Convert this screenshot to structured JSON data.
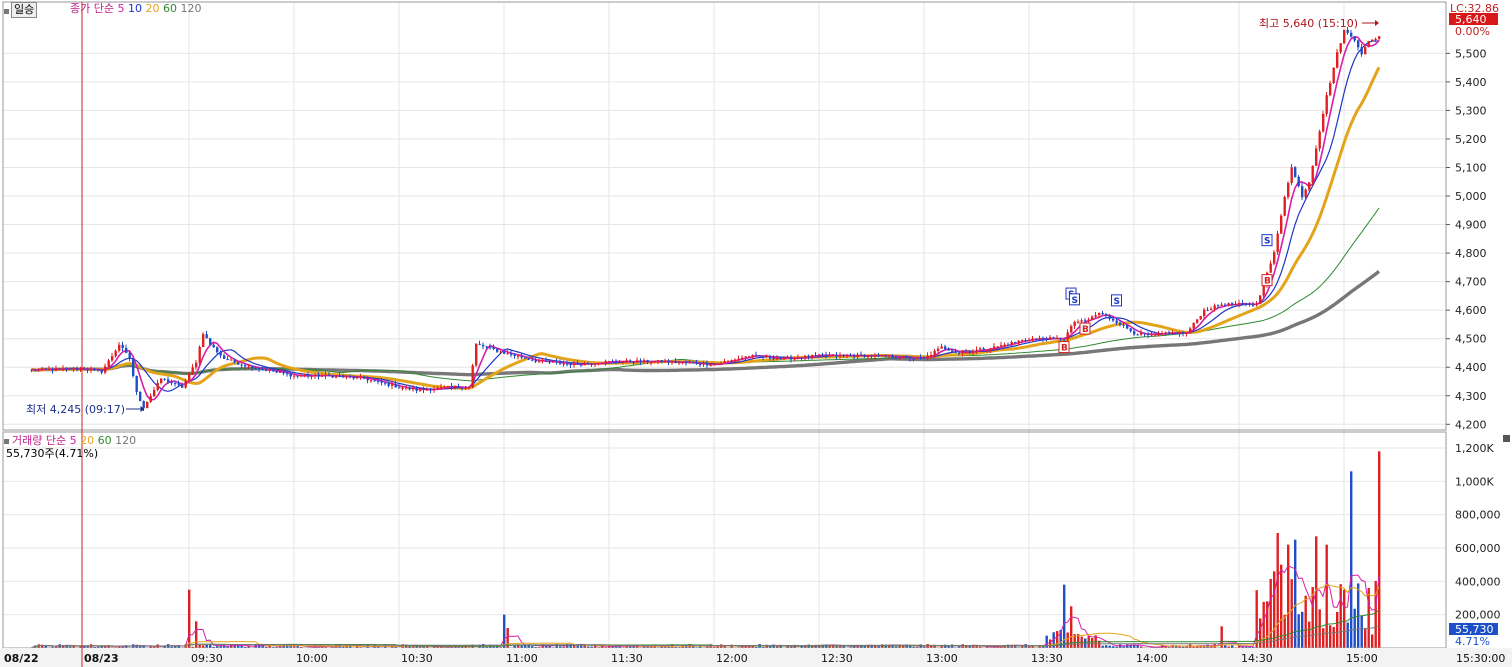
{
  "toolbar": {
    "period_button": "일승"
  },
  "price_legend": {
    "label": "종가 단순",
    "periods": [
      {
        "v": "5",
        "color": "#d81ea9"
      },
      {
        "v": "10",
        "color": "#1c36c9"
      },
      {
        "v": "20",
        "color": "#e3a41a"
      },
      {
        "v": "60",
        "color": "#2f8a2f"
      },
      {
        "v": "120",
        "color": "#777777"
      }
    ]
  },
  "volume_legend": {
    "label": "거래량 단순",
    "periods": [
      {
        "v": "5",
        "color": "#d81ea9"
      },
      {
        "v": "20",
        "color": "#e3a41a"
      },
      {
        "v": "60",
        "color": "#2f8a2f"
      },
      {
        "v": "120",
        "color": "#777777"
      }
    ],
    "current": "55,730주(4.71%)"
  },
  "axis_badges": {
    "lc": "LC:32.86",
    "last_price": "5,640",
    "change": "0.00%",
    "last_volume": "55,730",
    "volume_pct": "4.71%"
  },
  "annotations": {
    "high": "최고 5,640 (15:10)",
    "low": "최저 4,245 (09:17)"
  },
  "colors": {
    "up": "#e02020",
    "down": "#1c4fc8",
    "grid": "#e6e6e6"
  },
  "chart_data": {
    "type": "candlestick+volume",
    "x_axis_labels": [
      "08/22",
      "08/23",
      "09:30",
      "10:00",
      "10:30",
      "11:00",
      "11:30",
      "12:00",
      "12:30",
      "13:00",
      "13:30",
      "14:00",
      "14:30",
      "15:00",
      "15:30:00"
    ],
    "price_axis": {
      "ticks": [
        "4,200",
        "4,300",
        "4,400",
        "4,500",
        "4,600",
        "4,700",
        "4,800",
        "4,900",
        "5,000",
        "5,100",
        "5,200",
        "5,300",
        "5,400",
        "5,500"
      ],
      "ylim": [
        4180,
        5680
      ]
    },
    "volume_axis": {
      "ticks": [
        "200,000",
        "400,000",
        "600,000",
        "800,000",
        "1,000K",
        "1,200K"
      ],
      "ylim": [
        0,
        1200000
      ]
    },
    "time_start": "08:45",
    "interval_minutes": 1,
    "close_path": [
      [
        "08:45",
        4390
      ],
      [
        "09:00",
        4395
      ],
      [
        "09:05",
        4385
      ],
      [
        "09:08",
        4440
      ],
      [
        "09:10",
        4480
      ],
      [
        "09:13",
        4430
      ],
      [
        "09:15",
        4310
      ],
      [
        "09:17",
        4260
      ],
      [
        "09:22",
        4360
      ],
      [
        "09:28",
        4330
      ],
      [
        "09:32",
        4420
      ],
      [
        "09:34",
        4520
      ],
      [
        "09:36",
        4480
      ],
      [
        "09:40",
        4430
      ],
      [
        "09:45",
        4410
      ],
      [
        "09:50",
        4395
      ],
      [
        "10:00",
        4370
      ],
      [
        "10:10",
        4370
      ],
      [
        "10:20",
        4360
      ],
      [
        "10:30",
        4330
      ],
      [
        "10:35",
        4320
      ],
      [
        "10:45",
        4330
      ],
      [
        "10:50",
        4330
      ],
      [
        "10:52",
        4480
      ],
      [
        "10:55",
        4470
      ],
      [
        "11:00",
        4450
      ],
      [
        "11:10",
        4420
      ],
      [
        "11:20",
        4410
      ],
      [
        "11:30",
        4420
      ],
      [
        "11:45",
        4420
      ],
      [
        "12:00",
        4410
      ],
      [
        "12:10",
        4440
      ],
      [
        "12:20",
        4430
      ],
      [
        "12:30",
        4440
      ],
      [
        "12:45",
        4440
      ],
      [
        "13:00",
        4430
      ],
      [
        "13:05",
        4470
      ],
      [
        "13:10",
        4450
      ],
      [
        "13:20",
        4470
      ],
      [
        "13:30",
        4500
      ],
      [
        "13:40",
        4500
      ],
      [
        "13:43",
        4560
      ],
      [
        "13:46",
        4560
      ],
      [
        "13:50",
        4590
      ],
      [
        "13:55",
        4560
      ],
      [
        "14:00",
        4520
      ],
      [
        "14:05",
        4510
      ],
      [
        "14:10",
        4520
      ],
      [
        "14:15",
        4520
      ],
      [
        "14:20",
        4600
      ],
      [
        "14:25",
        4620
      ],
      [
        "14:30",
        4620
      ],
      [
        "14:35",
        4620
      ],
      [
        "14:40",
        4800
      ],
      [
        "14:43",
        5000
      ],
      [
        "14:45",
        5100
      ],
      [
        "14:48",
        5000
      ],
      [
        "14:50",
        5050
      ],
      [
        "14:55",
        5350
      ],
      [
        "14:58",
        5500
      ],
      [
        "15:00",
        5580
      ],
      [
        "15:03",
        5550
      ],
      [
        "15:05",
        5500
      ],
      [
        "15:07",
        5540
      ],
      [
        "15:10",
        5560
      ]
    ],
    "volume_spikes": [
      [
        "09:30",
        350000
      ],
      [
        "09:32",
        160000
      ],
      [
        "11:00",
        200000
      ],
      [
        "11:01",
        120000
      ],
      [
        "13:40",
        380000
      ],
      [
        "13:42",
        250000
      ],
      [
        "14:25",
        130000
      ],
      [
        "14:38",
        280000
      ],
      [
        "14:40",
        460000
      ],
      [
        "14:41",
        690000
      ],
      [
        "14:42",
        500000
      ],
      [
        "14:44",
        620000
      ],
      [
        "14:46",
        650000
      ],
      [
        "14:52",
        670000
      ],
      [
        "14:55",
        620000
      ],
      [
        "15:00",
        350000
      ],
      [
        "15:02",
        1060000
      ],
      [
        "15:07",
        360000
      ],
      [
        "15:10",
        1180000
      ]
    ],
    "signals": [
      {
        "time": "13:40",
        "type": "B"
      },
      {
        "time": "13:42",
        "type": "S"
      },
      {
        "time": "13:43",
        "type": "S"
      },
      {
        "time": "13:46",
        "type": "B"
      },
      {
        "time": "13:55",
        "type": "S"
      },
      {
        "time": "14:38",
        "type": "S"
      },
      {
        "time": "14:38",
        "type": "B"
      }
    ],
    "high": {
      "time": "15:10",
      "value": 5640
    },
    "low": {
      "time": "09:17",
      "value": 4245
    }
  }
}
